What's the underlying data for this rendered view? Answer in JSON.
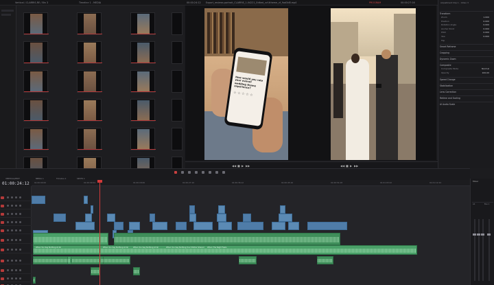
{
  "app": {
    "media_bin_title": "Vertical / CLARRIS-RE / Bin 3",
    "bin_subtitle": "Timeline 1 - MEDIA",
    "viewer_title": "Export_reviews.portrait_CLARRIS_1-04221_Edited_vcf-ttheme_vf_9ad3d8.mp4",
    "viewer_tc_left": "00:00:24:12",
    "viewer_tc_right": "00:00:27:16",
    "viewer_zoom": "Fit",
    "program_tag": "PROGRAM",
    "right_title": "Adjustment Clip 1 - Video 3"
  },
  "phone_screen": {
    "question": "How would you rate your overall wedding theme experience?",
    "stars": "☆ ☆ ☆ ☆ ☆"
  },
  "inspector": {
    "section_transform": "Transform",
    "rows": [
      {
        "label": "Zoom",
        "value": "1.000"
      },
      {
        "label": "Position",
        "value": "0.000"
      },
      {
        "label": "Rotation Angle",
        "value": "0.000"
      },
      {
        "label": "Anchor Point",
        "value": "0.000"
      },
      {
        "label": "Pitch",
        "value": "0.000"
      },
      {
        "label": "Yaw",
        "value": "0.000"
      },
      {
        "label": "Flip",
        "value": ""
      }
    ],
    "section_smart_reframe": "Smart Reframe",
    "section_cropping": "Cropping",
    "section_dynamic_zoom": "Dynamic Zoom",
    "section_composite": "Composite",
    "composite_mode_label": "Composite Mode",
    "composite_mode_value": "Normal",
    "opacity_label": "Opacity",
    "opacity_value": "100.00",
    "sections": [
      "Speed Change",
      "Stabilization",
      "Lens Correction",
      "Retime and Scaling",
      "AI Audio Scale"
    ]
  },
  "timeline": {
    "timecode": "01:00:24:12",
    "tabs": [
      "VERTICAL/EDIT",
      "MEDIA 1",
      "Timeline 1",
      "SPOTS 1"
    ],
    "ruler": [
      "01:00:00:00",
      "01:00:09:04",
      "01:00:18:06",
      "01:00:27:10",
      "01:00:36:12",
      "01:00:45:16",
      "01:00:54:18",
      "01:01:03:22",
      "01:01:12:24",
      "01:01:22:02"
    ],
    "audio_clip_labels": [
      "When You Say Nothing At All",
      "When You Say Nothing At All",
      "When You Say Nothing At All",
      "When You Say Nothing Your Mother Shared",
      "When The Night Feels"
    ],
    "track_names": [
      "V6",
      "V5",
      "V4",
      "V3",
      "V2",
      "V1",
      "A1",
      "A2",
      "A3",
      "A4",
      "A5"
    ]
  },
  "mixer": {
    "title": "Mixer",
    "channels": [
      "A1",
      "A2",
      "A3",
      "Bus 1"
    ]
  },
  "colors": {
    "video_clip": "#5b8ab4",
    "audio_clip": "#3f8e5a",
    "playhead": "#d23a3a",
    "track_badge": "#b53a3a"
  }
}
